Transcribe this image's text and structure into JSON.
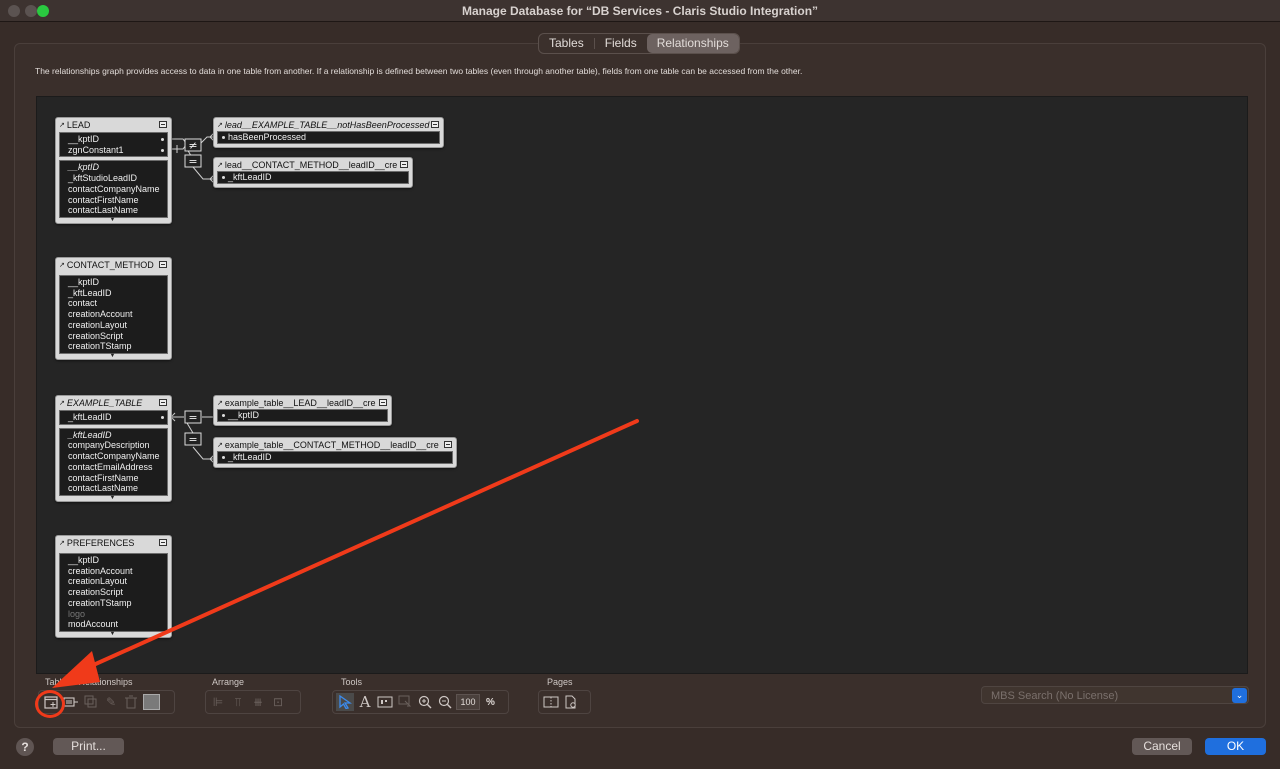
{
  "window": {
    "title": "Manage Database for “DB Services - Claris Studio Integration”"
  },
  "tabs": [
    {
      "label": "Tables",
      "active": false
    },
    {
      "label": "Fields",
      "active": false
    },
    {
      "label": "Relationships",
      "active": true
    }
  ],
  "description": "The relationships graph provides access to data in one table from another. If a relationship is defined between two tables (even through another table), fields from one table can be accessed from the other.",
  "graph": {
    "tables": [
      {
        "name": "LEAD",
        "italic_name": false,
        "key_fields": [
          "__kptID",
          "zgnConstant1"
        ],
        "fields": [
          {
            "name": "__kptID",
            "style": "italic"
          },
          {
            "name": "_kftStudioLeadID",
            "style": "normal"
          },
          {
            "name": "contactCompanyName",
            "style": "normal"
          },
          {
            "name": "contactFirstName",
            "style": "normal"
          },
          {
            "name": "contactLastName",
            "style": "normal"
          }
        ]
      },
      {
        "name": "CONTACT_METHOD",
        "italic_name": false,
        "key_fields": [],
        "fields": [
          {
            "name": "__kptID",
            "style": "normal"
          },
          {
            "name": "_kftLeadID",
            "style": "normal"
          },
          {
            "name": "contact",
            "style": "normal"
          },
          {
            "name": "creationAccount",
            "style": "normal"
          },
          {
            "name": "creationLayout",
            "style": "normal"
          },
          {
            "name": "creationScript",
            "style": "normal"
          },
          {
            "name": "creationTStamp",
            "style": "normal"
          }
        ]
      },
      {
        "name": "EXAMPLE_TABLE",
        "italic_name": true,
        "key_fields": [
          "_kftLeadID"
        ],
        "fields": [
          {
            "name": "_kftLeadID",
            "style": "italic"
          },
          {
            "name": "companyDescription",
            "style": "normal"
          },
          {
            "name": "contactCompanyName",
            "style": "normal"
          },
          {
            "name": "contactEmailAddress",
            "style": "normal"
          },
          {
            "name": "contactFirstName",
            "style": "normal"
          },
          {
            "name": "contactLastName",
            "style": "normal"
          }
        ]
      },
      {
        "name": "PREFERENCES",
        "italic_name": false,
        "key_fields": [],
        "fields": [
          {
            "name": "__kptID",
            "style": "normal"
          },
          {
            "name": "creationAccount",
            "style": "normal"
          },
          {
            "name": "creationLayout",
            "style": "normal"
          },
          {
            "name": "creationScript",
            "style": "normal"
          },
          {
            "name": "creationTStamp",
            "style": "normal"
          },
          {
            "name": "logo",
            "style": "dim"
          },
          {
            "name": "modAccount",
            "style": "normal"
          }
        ]
      }
    ],
    "occurrences": [
      {
        "name": "lead__EXAMPLE_TABLE__notHasBeenProcessed",
        "italic_name": true,
        "key_field": "hasBeenProcessed",
        "operator": "≠"
      },
      {
        "name": "lead__CONTACT_METHOD__leadID__cre",
        "italic_name": false,
        "key_field": "_kftLeadID",
        "operator": "="
      },
      {
        "name": "example_table__LEAD__leadID__cre",
        "italic_name": false,
        "key_field": "__kptID",
        "operator": "="
      },
      {
        "name": "example_table__CONTACT_METHOD__leadID__cre",
        "italic_name": false,
        "key_field": "_kftLeadID",
        "operator": "="
      }
    ]
  },
  "toolbar": {
    "groups": {
      "tables_relationships": "Tables / Relationships",
      "arrange": "Arrange",
      "tools": "Tools",
      "pages": "Pages"
    },
    "zoom_value": "100",
    "zoom_unit": "%"
  },
  "mbs_search": {
    "placeholder": "MBS Search (No License)"
  },
  "buttons": {
    "help": "?",
    "print": "Print...",
    "cancel": "Cancel",
    "ok": "OK"
  },
  "colors": {
    "accent": "#1f6fde",
    "annotation": "#f03a1a",
    "canvas": "#252525"
  }
}
